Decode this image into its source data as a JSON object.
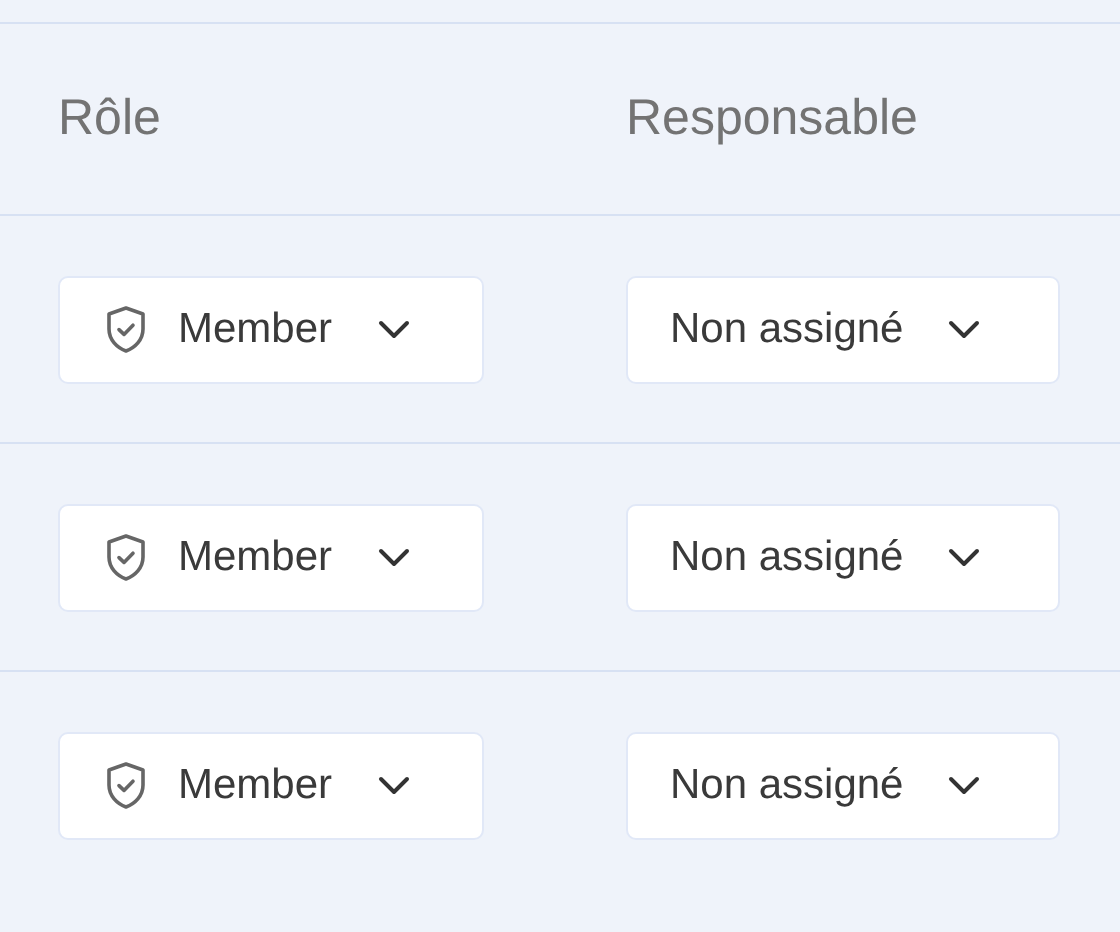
{
  "table": {
    "columns": [
      "Rôle",
      "Responsable"
    ],
    "rows": [
      {
        "role": "Member",
        "owner": "Non assigné"
      },
      {
        "role": "Member",
        "owner": "Non assigné"
      },
      {
        "role": "Member",
        "owner": "Non assigné"
      }
    ]
  }
}
